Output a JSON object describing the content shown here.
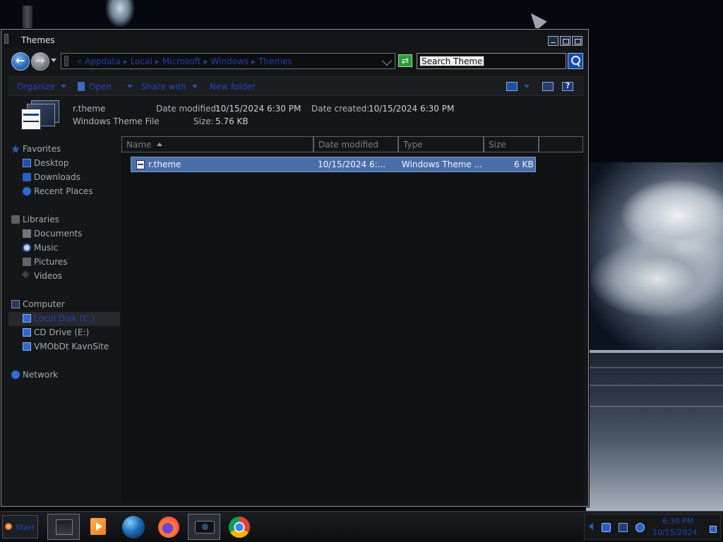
{
  "window": {
    "title": "Themes"
  },
  "address": {
    "crumbs": [
      "Appdata",
      "Local",
      "Microsoft",
      "Windows",
      "Themes"
    ],
    "prefix": "«"
  },
  "search": {
    "value": "Search Themes"
  },
  "toolbar": {
    "organize": "Organize",
    "open": "Open",
    "share_with": "Share with",
    "new_folder": "New folder"
  },
  "details": {
    "name": "r.theme",
    "type": "Windows Theme File",
    "date_modified_label": "Date modified:",
    "date_modified": "10/15/2024 6:30 PM",
    "date_created_label": "Date created:",
    "date_created": "10/15/2024 6:30 PM",
    "size_label": "Size:",
    "size": "5.76 KB"
  },
  "nav": {
    "favorites": "Favorites",
    "desktop": "Desktop",
    "downloads": "Downloads",
    "recent": "Recent Places",
    "libraries": "Libraries",
    "documents": "Documents",
    "music": "Music",
    "pictures": "Pictures",
    "videos": "Videos",
    "computer": "Computer",
    "local_disk": "Local Disk (C:)",
    "cd_drive": "CD Drive (E:)",
    "vm_share": "VMObDt KavnSite",
    "network": "Network"
  },
  "columns": {
    "name": "Name",
    "date_modified": "Date modified",
    "type": "Type",
    "size": "Size"
  },
  "files": [
    {
      "name": "r.theme",
      "date_modified": "10/15/2024 6:...",
      "type": "Windows Theme ...",
      "size": "6 KB"
    }
  ],
  "taskbar": {
    "start": "Start",
    "apps": [
      "explorer",
      "media-player",
      "globe",
      "firefox",
      "camera",
      "chrome"
    ]
  },
  "clock": {
    "time": "6:30 PM",
    "date": "10/15/2024"
  },
  "colors": {
    "accent_blue": "#1c49b8",
    "selection": "#4a6ea8",
    "window_bg": "#151618"
  }
}
